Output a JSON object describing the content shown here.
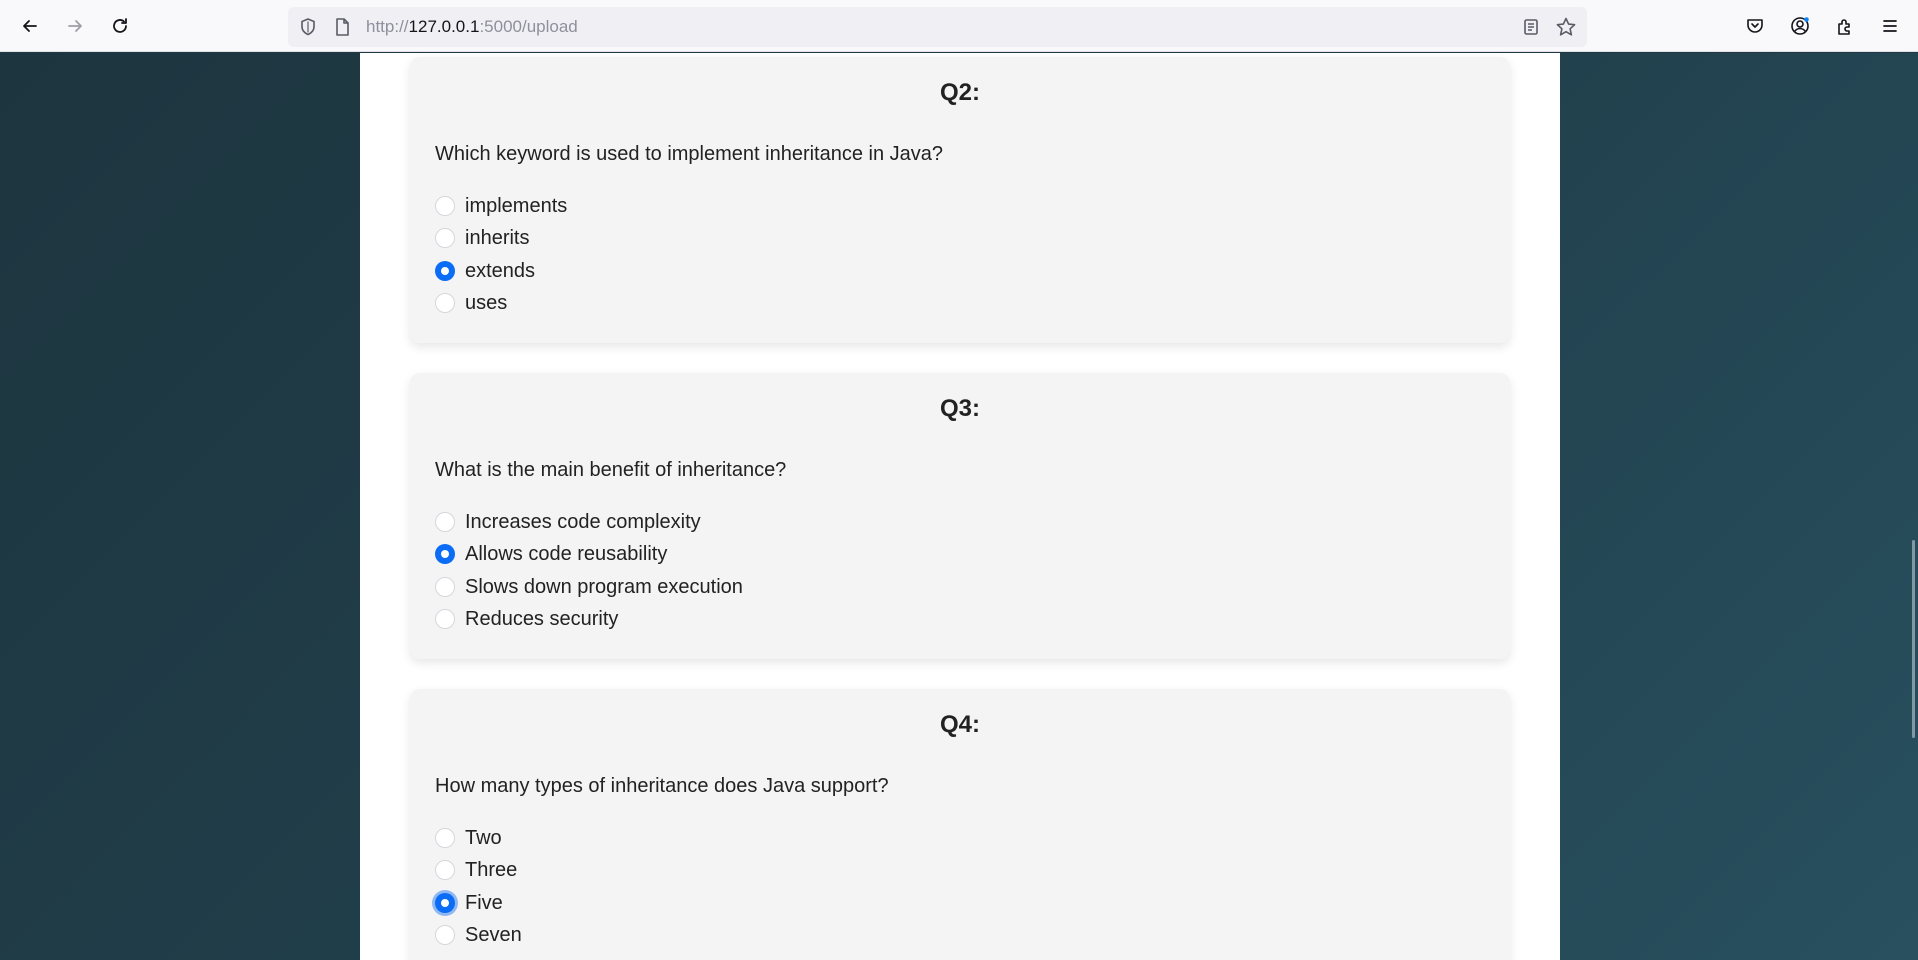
{
  "browser": {
    "url_prefix": "http://",
    "url_host": "127.0.0.1",
    "url_rest": ":5000/upload"
  },
  "questions": [
    {
      "title": "Q2:",
      "text": "Which keyword is used to implement inheritance in Java?",
      "options": [
        "implements",
        "inherits",
        "extends",
        "uses"
      ],
      "selected": 2
    },
    {
      "title": "Q3:",
      "text": "What is the main benefit of inheritance?",
      "options": [
        "Increases code complexity",
        "Allows code reusability",
        "Slows down program execution",
        "Reduces security"
      ],
      "selected": 1
    },
    {
      "title": "Q4:",
      "text": "How many types of inheritance does Java support?",
      "options": [
        "Two",
        "Three",
        "Five",
        "Seven"
      ],
      "selected": 2
    }
  ]
}
